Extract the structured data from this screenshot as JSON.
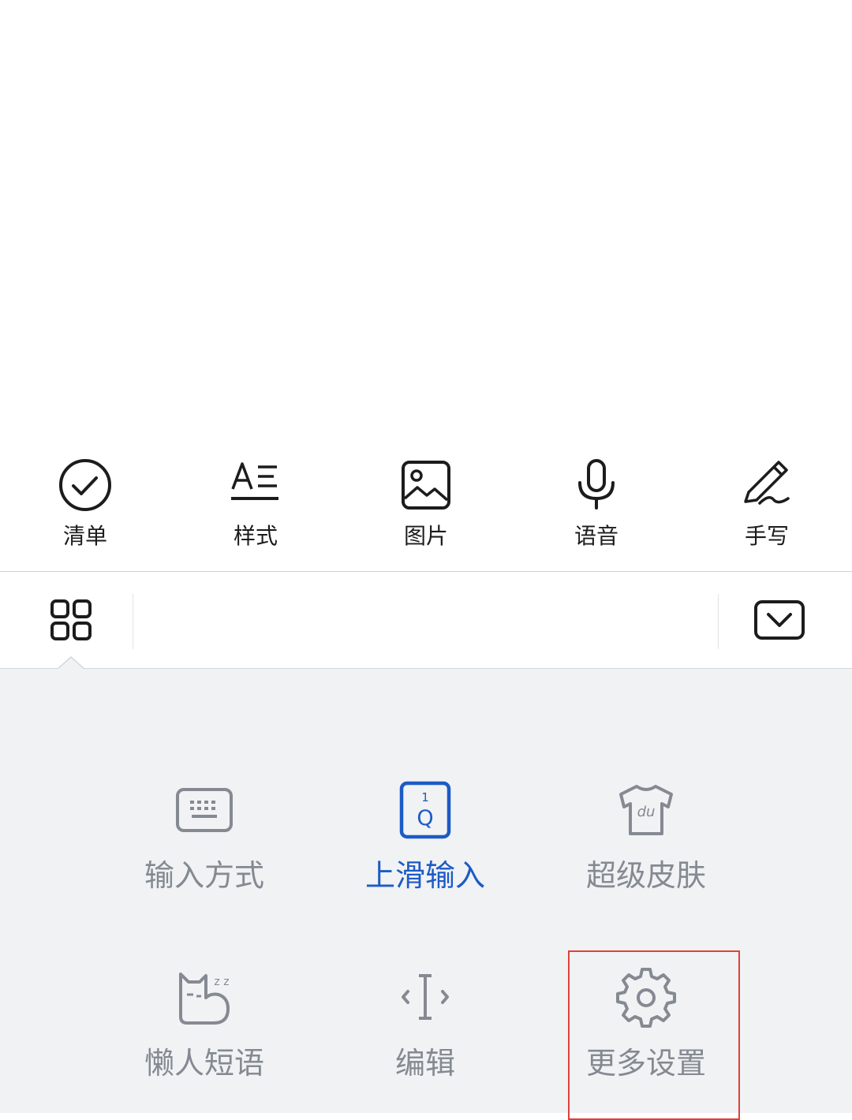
{
  "toolbar": {
    "items": [
      {
        "label": "清单",
        "icon": "checklist-icon"
      },
      {
        "label": "样式",
        "icon": "text-style-icon"
      },
      {
        "label": "图片",
        "icon": "image-icon"
      },
      {
        "label": "语音",
        "icon": "microphone-icon"
      },
      {
        "label": "手写",
        "icon": "pen-icon"
      }
    ]
  },
  "keyboard_bar": {
    "apps_icon": "grid-icon",
    "hide_icon": "keyboard-hide-icon"
  },
  "panel": {
    "items": [
      {
        "label": "输入方式",
        "icon": "keyboard-icon",
        "active": false
      },
      {
        "label": "上滑输入",
        "icon": "swipe-key-icon",
        "active": true,
        "key_number": "1",
        "key_letter": "Q"
      },
      {
        "label": "超级皮肤",
        "icon": "tshirt-icon",
        "active": false,
        "badge": "du"
      },
      {
        "label": "懒人短语",
        "icon": "lazy-cat-icon",
        "active": false,
        "sleep_text": "z z"
      },
      {
        "label": "编辑",
        "icon": "text-cursor-icon",
        "active": false
      },
      {
        "label": "更多设置",
        "icon": "gear-icon",
        "active": false,
        "highlighted": true
      }
    ]
  },
  "colors": {
    "accent": "#1c5bc6",
    "muted": "#858a92",
    "panel_bg": "#f0f2f4",
    "highlight": "#e0413b"
  }
}
